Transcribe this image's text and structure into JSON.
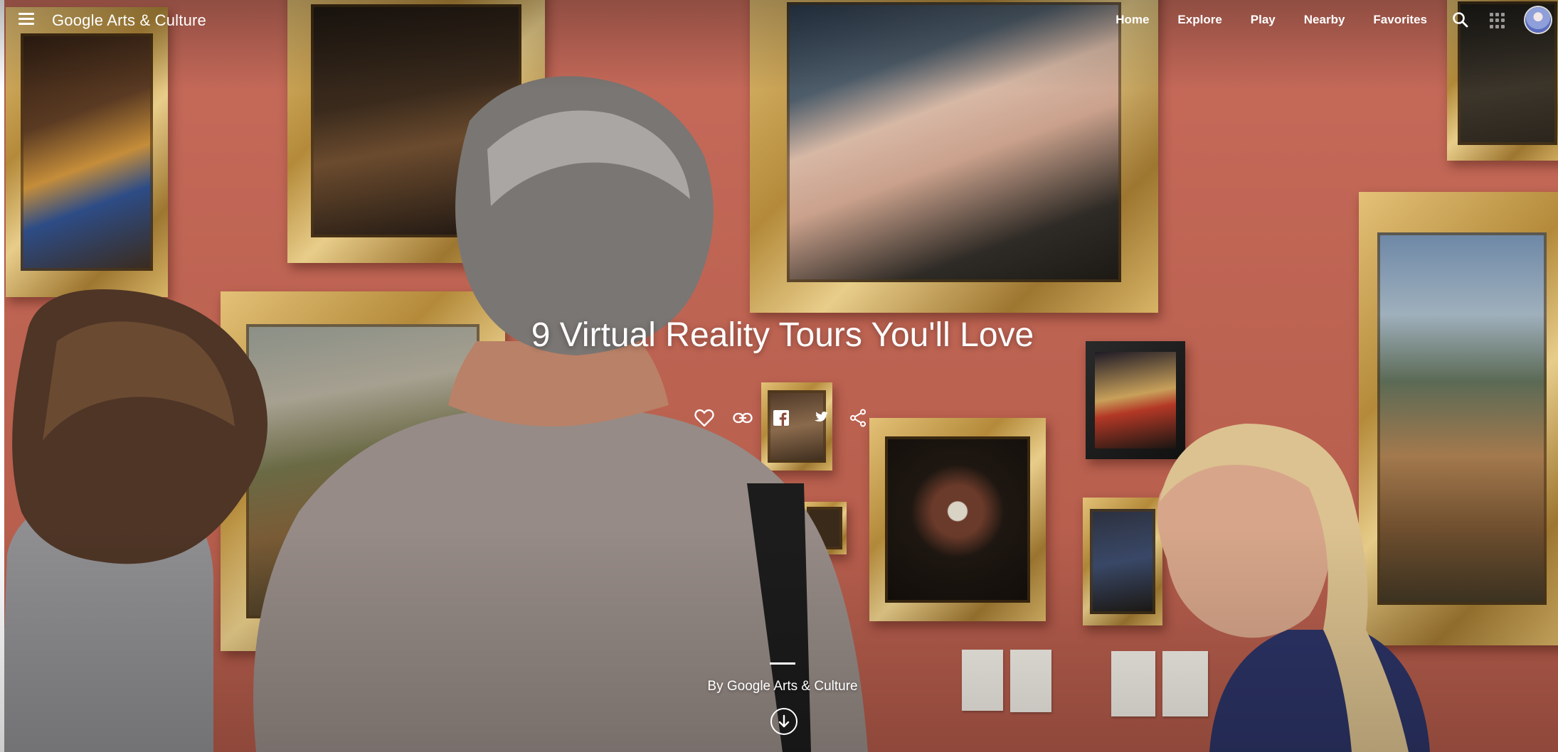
{
  "header": {
    "logo_text": "Google Arts & Culture",
    "nav": [
      {
        "label": "Home"
      },
      {
        "label": "Explore"
      },
      {
        "label": "Play"
      },
      {
        "label": "Nearby"
      },
      {
        "label": "Favorites"
      }
    ],
    "icons": {
      "menu": "menu-icon",
      "search": "search-icon",
      "apps": "apps-grid-icon",
      "account": "account-avatar"
    }
  },
  "hero": {
    "title": "9 Virtual Reality Tours You'll Love",
    "byline": "By Google Arts & Culture",
    "share_actions": [
      {
        "icon": "heart-icon"
      },
      {
        "icon": "link-icon"
      },
      {
        "icon": "facebook-icon"
      },
      {
        "icon": "twitter-icon"
      },
      {
        "icon": "share-icon"
      }
    ],
    "scroll_icon": "arrow-down-circle-icon"
  },
  "colors": {
    "wall": "#b4604f",
    "text": "#ffffff",
    "frame_gold": "#c9a352"
  }
}
